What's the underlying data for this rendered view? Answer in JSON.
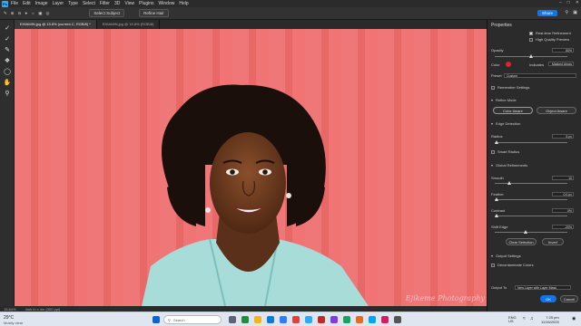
{
  "menu": {
    "items": [
      "File",
      "Edit",
      "Image",
      "Layer",
      "Type",
      "Select",
      "Filter",
      "3D",
      "View",
      "Plugins",
      "Window",
      "Help"
    ]
  },
  "options": {
    "select_subject": "Select Subject",
    "refine_hair": "Refine Hair",
    "share": "Share"
  },
  "tabs": [
    {
      "label": "EHIAMIN.jpg @ 15.8% (current.C, RGB/8) *"
    },
    {
      "label": "EHIAMIN.jpg @ 15.8% (RGB/8)"
    }
  ],
  "status": {
    "zoom": "15.84%",
    "doc": "4mb in x 4m (300 ppi)"
  },
  "panel": {
    "title": "Properties",
    "real_time": "Real-time Refinement",
    "high_quality": "High Quality Preview",
    "opacity_label": "Opacity",
    "opacity_val": "50%",
    "color_label": "Color",
    "indicates_label": "Indicates",
    "indicates_val": "Masked Areas",
    "preset_label": "Preset",
    "preset_val": "Custom",
    "remember": "Remember Settings",
    "refine_mode": "Refine Mode",
    "color_aware": "Color Aware",
    "object_aware": "Object Aware",
    "edge_detection": "Edge Detection",
    "radius_label": "Radius",
    "radius_val": "5 px",
    "smart_radius": "Smart Radius",
    "global_ref": "Global Refinements",
    "smooth_label": "Smooth",
    "smooth_val": "10",
    "feather_label": "Feather",
    "feather_val": "0.0 px",
    "contrast_label": "Contrast",
    "contrast_val": "0%",
    "shift_label": "Shift Edge",
    "shift_val": "-20%",
    "clear_sel": "Clear Selection",
    "invert": "Invert",
    "output": "Output Settings",
    "decontaminate": "Decontaminate Colors",
    "output_to": "Output To",
    "output_to_val": "New Layer with Layer Mask",
    "ok": "OK",
    "cancel": "Cancel",
    "accent": "#1473e6",
    "mask_color": "#e0242a"
  },
  "taskbar": {
    "weather_temp": "29°C",
    "weather_desc": "Mostly clear",
    "search": "Search",
    "lang": "ENG\nUS",
    "time": "7:25 pm",
    "date": "11/16/2025"
  },
  "watermark": "Ejikeme Photography"
}
